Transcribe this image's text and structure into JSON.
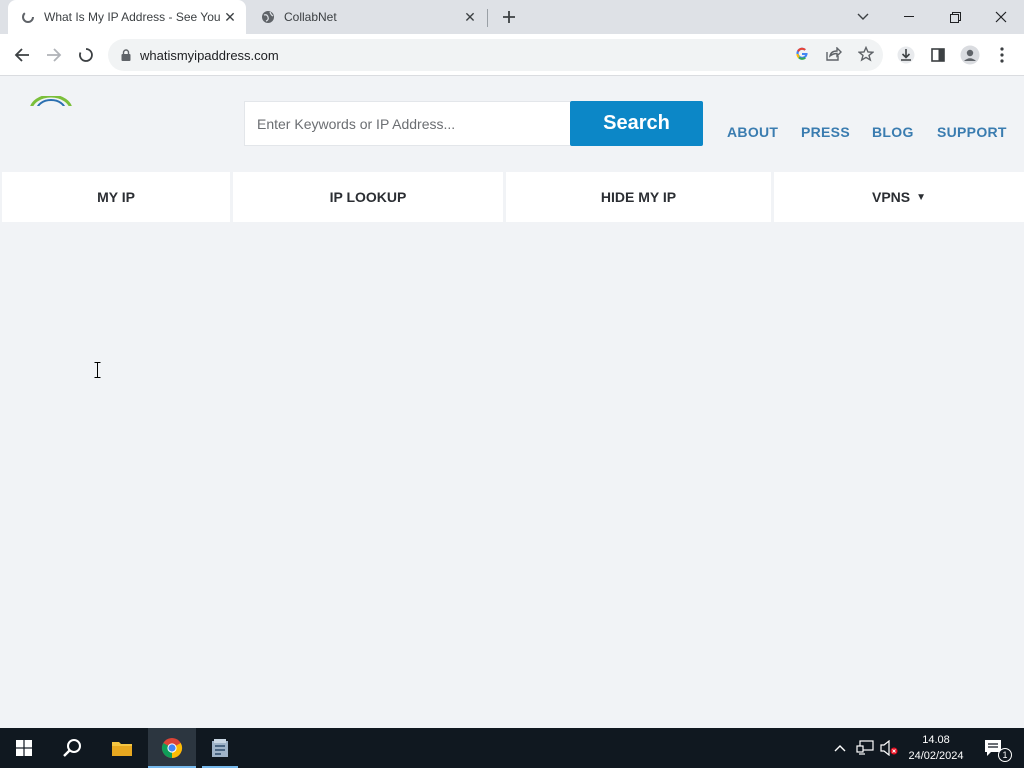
{
  "browser": {
    "tabs": [
      {
        "title": "What Is My IP Address - See Your",
        "active": true
      },
      {
        "title": "CollabNet",
        "active": false
      }
    ],
    "address_bar": {
      "url": "whatismyipaddress.com"
    }
  },
  "page": {
    "search": {
      "placeholder": "Enter Keywords or IP Address...",
      "button_label": "Search"
    },
    "top_links": [
      "ABOUT",
      "PRESS",
      "BLOG",
      "SUPPORT"
    ],
    "nav": [
      {
        "label": "MY IP"
      },
      {
        "label": "IP LOOKUP"
      },
      {
        "label": "HIDE MY IP"
      },
      {
        "label": "VPNS",
        "caret": "▼"
      }
    ],
    "colors": {
      "search_button": "#0c87c7",
      "link": "#3a7cb0",
      "page_bg": "#f1f3f6"
    }
  },
  "taskbar": {
    "apps": [
      "start-icon",
      "search-icon",
      "file-explorer-icon",
      "chrome-icon",
      "app-icon"
    ],
    "time": "14.08",
    "date": "24/02/2024",
    "notification_count": "1"
  }
}
